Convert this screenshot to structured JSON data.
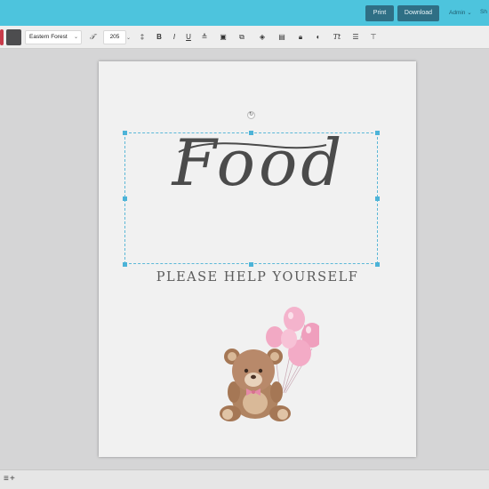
{
  "header": {
    "print_label": "Print",
    "download_label": "Download",
    "admin_label": "Admin ⌄",
    "share_label": "Sh"
  },
  "toolbar": {
    "font_family": "Eastern Forest",
    "font_size": "205"
  },
  "canvas": {
    "title_text": "Food",
    "subtitle_text": "PLEASE HELP YOURSELF"
  },
  "colors": {
    "topbar": "#4dc4dd",
    "button": "#2f6f85",
    "selection": "#5cb8d7",
    "swatch_red": "#c83b4a",
    "swatch_dark": "#4d4d4f"
  },
  "icons": [
    "font-style-icon",
    "letter-spacing-icon",
    "bold-icon",
    "italic-icon",
    "underline-icon",
    "strikethrough-icon",
    "image-icon",
    "duplicate-icon",
    "layers-icon",
    "copy-icon",
    "lock-icon",
    "color-icon",
    "text-transform-icon",
    "line-spacing-icon",
    "align-icon",
    "rotate-icon",
    "teddy-bear-balloons-image"
  ]
}
